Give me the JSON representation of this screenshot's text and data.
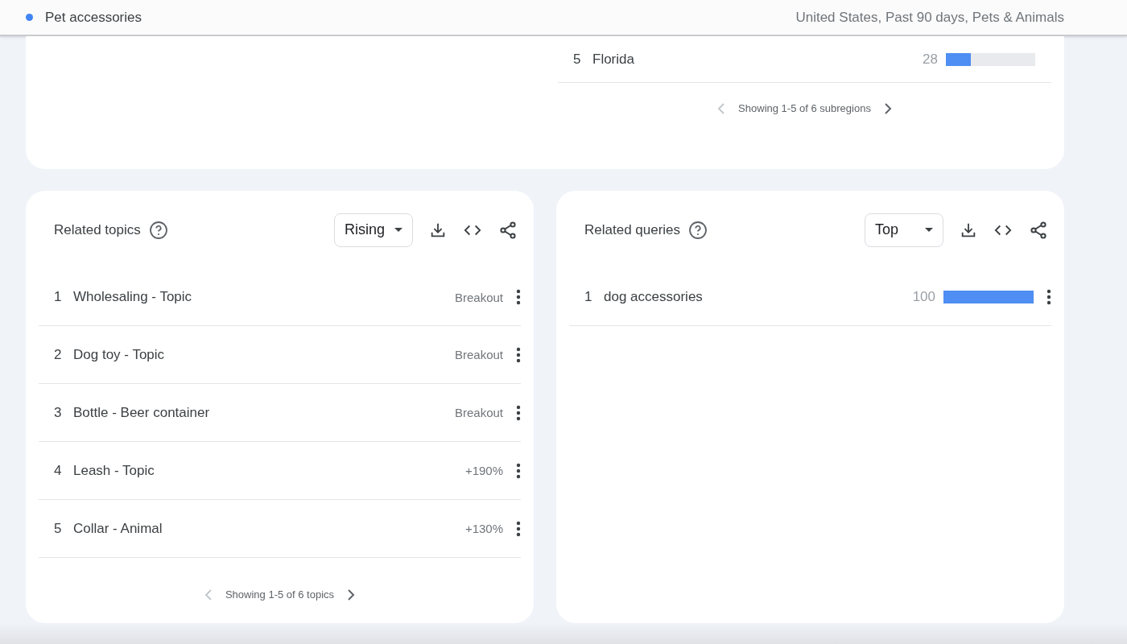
{
  "header": {
    "term": "Pet accessories",
    "color": "#4285f4",
    "filters": "United States, Past 90 days, Pets & Animals"
  },
  "subregions": {
    "rows": [
      {
        "rank": "5",
        "name": "Florida",
        "value": "28",
        "level": 0.28
      }
    ],
    "pagination": {
      "text": "Showing 1-5 of 6 subregions",
      "prev_disabled": true,
      "next_disabled": false
    }
  },
  "related_topics": {
    "title": "Related topics",
    "filter": "Rising",
    "rows": [
      {
        "rank": "1",
        "name": "Wholesaling - Topic",
        "value": "Breakout"
      },
      {
        "rank": "2",
        "name": "Dog toy - Topic",
        "value": "Breakout"
      },
      {
        "rank": "3",
        "name": "Bottle - Beer container",
        "value": "Breakout"
      },
      {
        "rank": "4",
        "name": "Leash - Topic",
        "value": "+190%"
      },
      {
        "rank": "5",
        "name": "Collar - Animal",
        "value": "+130%"
      }
    ],
    "pagination": {
      "text": "Showing 1-5 of 6 topics",
      "prev_disabled": true,
      "next_disabled": false
    }
  },
  "related_queries": {
    "title": "Related queries",
    "filter": "Top",
    "rows": [
      {
        "rank": "1",
        "name": "dog accessories",
        "value": "100",
        "level": 1
      }
    ]
  }
}
